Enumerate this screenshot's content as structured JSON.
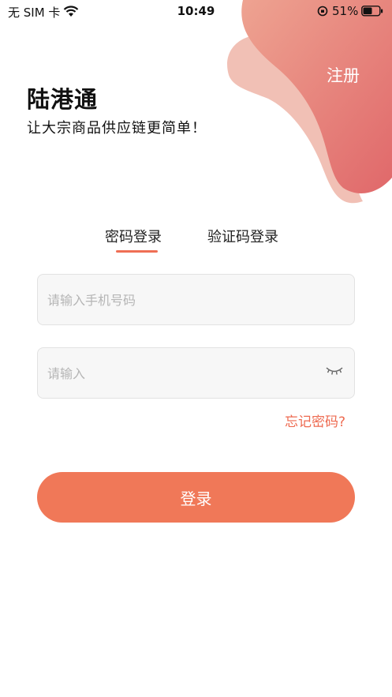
{
  "status_bar": {
    "carrier": "无 SIM 卡",
    "time": "10:49",
    "battery": "51%"
  },
  "header": {
    "register_label": "注册",
    "logo_text": "陆港通",
    "slogan": "让大宗商品供应链更简单！"
  },
  "tabs": [
    {
      "label": "密码登录",
      "active": true
    },
    {
      "label": "验证码登录",
      "active": false
    }
  ],
  "form": {
    "phone_placeholder": "请输入手机号码",
    "password_placeholder": "请输入",
    "forgot_label": "忘记密码?",
    "login_label": "登录"
  },
  "colors": {
    "accent": "#f07858",
    "blob_dark": "#e0706a",
    "blob_light": "#eeb3a6"
  },
  "icons": {
    "password_toggle": "eye-closed-icon"
  }
}
